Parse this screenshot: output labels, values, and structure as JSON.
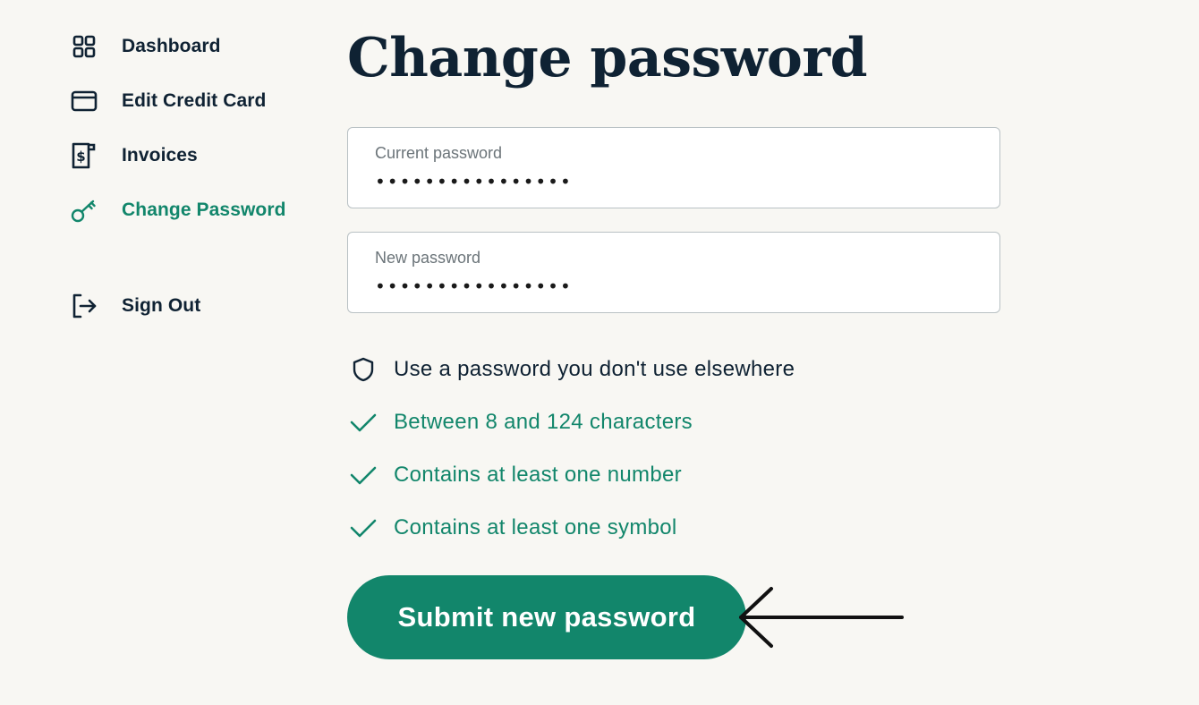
{
  "sidebar": {
    "items": [
      {
        "label": "Dashboard",
        "icon": "grid-icon"
      },
      {
        "label": "Edit Credit Card",
        "icon": "credit-card-icon"
      },
      {
        "label": "Invoices",
        "icon": "invoice-icon"
      },
      {
        "label": "Change Password",
        "icon": "key-icon",
        "active": true
      }
    ],
    "sign_out": {
      "label": "Sign Out",
      "icon": "sign-out-icon"
    }
  },
  "main": {
    "title": "Change password",
    "current_password": {
      "label": "Current password",
      "value": "••••••••••••••••"
    },
    "new_password": {
      "label": "New password",
      "value": "••••••••••••••••"
    },
    "rules": [
      {
        "text": "Use a password you don't use elsewhere",
        "icon": "shield-icon"
      },
      {
        "text": "Between 8 and 124 characters",
        "icon": "check-icon"
      },
      {
        "text": "Contains at least one number",
        "icon": "check-icon"
      },
      {
        "text": "Contains at least one symbol",
        "icon": "check-icon"
      }
    ],
    "submit_label": "Submit new password"
  },
  "colors": {
    "background": "#f8f7f3",
    "accent": "#12866b",
    "text": "#0f2233",
    "field_border": "#b9c1c4"
  }
}
